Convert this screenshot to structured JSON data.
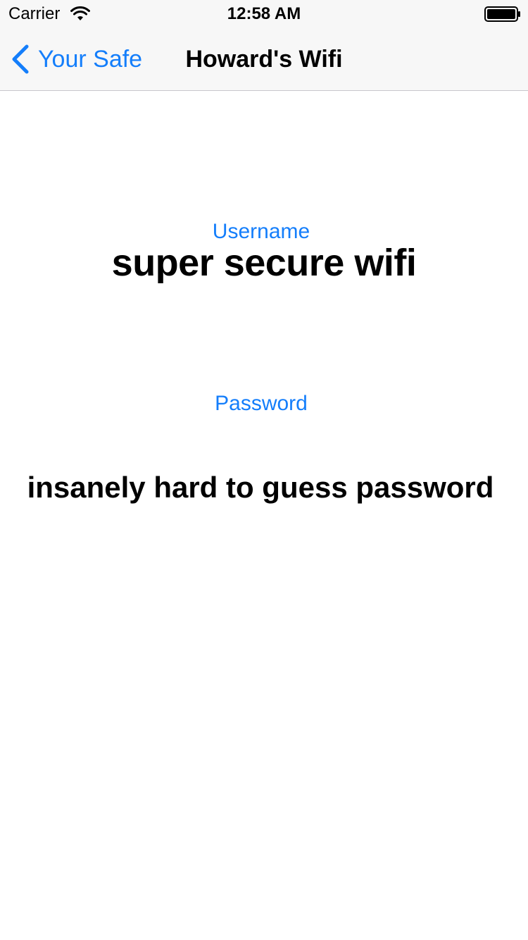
{
  "status_bar": {
    "carrier": "Carrier",
    "time": "12:58 AM",
    "wifi_icon": "wifi-icon",
    "battery_icon": "battery-icon"
  },
  "nav": {
    "back_label": "Your Safe",
    "back_icon": "chevron-left-icon",
    "title": "Howard's Wifi"
  },
  "content": {
    "username_label": "Username",
    "username_value": "super secure wifi",
    "password_label": "Password",
    "password_value": "insanely hard to guess password"
  },
  "colors": {
    "accent": "#147efb",
    "bar_background": "#f7f7f7",
    "text": "#000000"
  }
}
